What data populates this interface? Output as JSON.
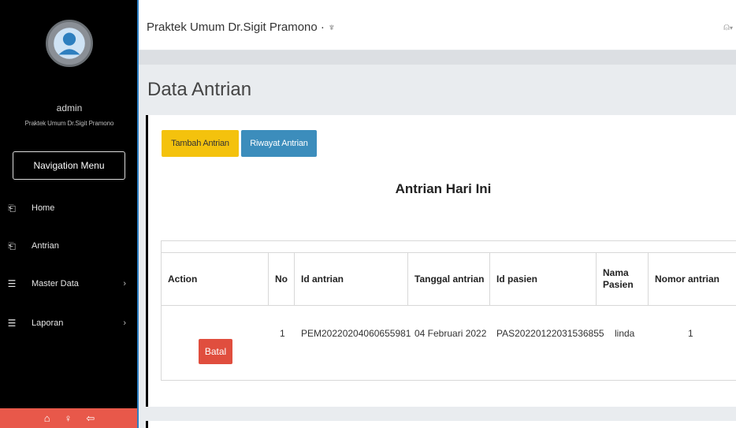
{
  "app": {
    "title": "Praktek Umum Dr.Sigit Pramono ·",
    "title_icon": "trophy-icon",
    "user_menu_icon": "user-icon"
  },
  "sidebar": {
    "user_name": "admin",
    "user_sub": "Praktek Umum Dr.Sigit Pramono",
    "nav_button": "Navigation Menu",
    "items": [
      {
        "label": "Home",
        "icon": "file-icon"
      },
      {
        "label": "Antrian",
        "icon": "file-icon"
      },
      {
        "label": "Master Data",
        "icon": "menu-icon",
        "chevron": "›"
      },
      {
        "label": "Laporan",
        "icon": "menu-icon",
        "chevron": "›"
      }
    ],
    "footer_icons": [
      "home-icon",
      "bulb-icon",
      "logout-icon"
    ],
    "accent": "#2c7fc4",
    "footer_color": "#e8584a"
  },
  "page": {
    "title": "Data Antrian",
    "buttons": {
      "tambah": "Tambah Antrian",
      "riwayat": "Riwayat Antrian"
    },
    "section_title": "Antrian Hari Ini"
  },
  "table": {
    "headers": [
      "Action",
      "No",
      "Id antrian",
      "Tanggal antrian",
      "Id pasien",
      "Nama Pasien",
      "Nomor antrian"
    ],
    "rows": [
      {
        "action": "Batal",
        "no": "1",
        "id_antrian": "PEM20220204060655981",
        "tanggal": "04 Februari 2022",
        "id_pasien": "PAS20220122031536855",
        "nama": "linda",
        "nomor": "1"
      }
    ]
  },
  "colors": {
    "yellow": "#f4c20d",
    "blue": "#3c8dbc",
    "danger": "#e04e3e"
  }
}
